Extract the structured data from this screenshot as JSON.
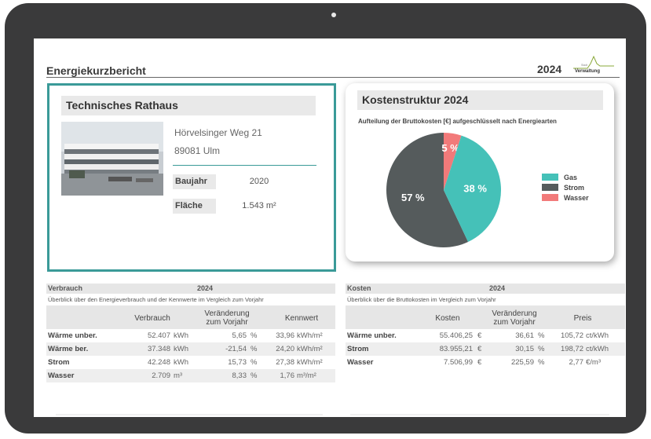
{
  "header": {
    "title": "Energiekurzbericht",
    "year": "2024",
    "logo_text": "Verwaltung",
    "logo_small": "Stadt"
  },
  "building": {
    "name": "Technisches Rathaus",
    "street": "Hörvelsinger Weg 21",
    "city": "89081 Ulm",
    "baujahr_label": "Baujahr",
    "baujahr_value": "2020",
    "flaeche_label": "Fläche",
    "flaeche_value": "1.543",
    "flaeche_unit": "m²"
  },
  "cost_structure": {
    "title": "Kostenstruktur 2024",
    "subtitle": "Aufteilung der Bruttokosten [€] aufgeschlüsselt nach Energiearten",
    "labels": {
      "strom": "57 %",
      "gas": "38 %",
      "wasser": "5 %"
    },
    "legend": [
      {
        "name": "Gas",
        "color": "#45c1b8"
      },
      {
        "name": "Strom",
        "color": "#555b5c"
      },
      {
        "name": "Wasser",
        "color": "#f27a7a"
      }
    ]
  },
  "chart_data": {
    "type": "pie",
    "categories": [
      "Gas",
      "Strom",
      "Wasser"
    ],
    "values": [
      38,
      57,
      5
    ],
    "colors": [
      "#45c1b8",
      "#555b5c",
      "#f27a7a"
    ]
  },
  "verbrauch": {
    "title": "Verbrauch",
    "year": "2024",
    "desc": "Überblick über den Energieverbrauch und der Kennwerte im Vergleich zum Vorjahr",
    "col_verbrauch": "Verbrauch",
    "col_change_1": "Veränderung",
    "col_change_2": "zum Vorjahr",
    "col_kennwert": "Kennwert",
    "rows": [
      {
        "name": "Wärme unber.",
        "value": "52.407",
        "unit": "kWh",
        "change": "5,65",
        "pct": "%",
        "kennwert": "33,96",
        "kunit": "kWh/m²"
      },
      {
        "name": "Wärme ber.",
        "value": "37.348",
        "unit": "kWh",
        "change": "-21,54",
        "pct": "%",
        "kennwert": "24,20",
        "kunit": "kWh/m²"
      },
      {
        "name": "Strom",
        "value": "42.248",
        "unit": "kWh",
        "change": "15,73",
        "pct": "%",
        "kennwert": "27,38",
        "kunit": "kWh/m²"
      },
      {
        "name": "Wasser",
        "value": "2.709",
        "unit": "m³",
        "change": "8,33",
        "pct": "%",
        "kennwert": "1,76",
        "kunit": "m³/m²"
      }
    ]
  },
  "kosten": {
    "title": "Kosten",
    "year": "2024",
    "desc": "Überblick über die Bruttokosten im Vergleich zum Vorjahr",
    "col_kosten": "Kosten",
    "col_change_1": "Veränderung",
    "col_change_2": "zum Vorjahr",
    "col_preis": "Preis",
    "rows": [
      {
        "name": "Wärme unber.",
        "value": "55.406,25",
        "unit": "€",
        "change": "36,61",
        "pct": "%",
        "preis": "105,72",
        "punit": "ct/kWh"
      },
      {
        "name": "Strom",
        "value": "83.955,21",
        "unit": "€",
        "change": "30,15",
        "pct": "%",
        "preis": "198,72",
        "punit": "ct/kWh"
      },
      {
        "name": "Wasser",
        "value": "7.506,99",
        "unit": "€",
        "change": "225,59",
        "pct": "%",
        "preis": "2,77",
        "punit": "€/m³"
      }
    ]
  }
}
